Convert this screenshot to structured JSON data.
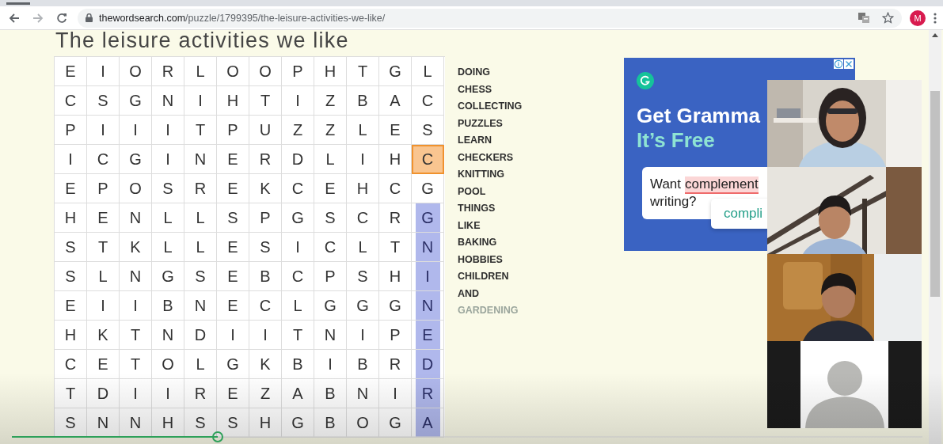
{
  "browser": {
    "url_host": "thewordsearch.com",
    "url_path": "/puzzle/1799395/the-leisure-activities-we-like/",
    "profile_initial": "M"
  },
  "page": {
    "title": "The leisure activities we like"
  },
  "grid": {
    "rows": [
      {
        "cells": [
          {
            "letter": "E",
            "selected": false,
            "found": false
          },
          {
            "letter": "I",
            "selected": false,
            "found": false
          },
          {
            "letter": "O",
            "selected": false,
            "found": false
          },
          {
            "letter": "R",
            "selected": false,
            "found": false
          },
          {
            "letter": "L",
            "selected": false,
            "found": false
          },
          {
            "letter": "O",
            "selected": false,
            "found": false
          },
          {
            "letter": "O",
            "selected": false,
            "found": false
          },
          {
            "letter": "P",
            "selected": false,
            "found": false
          },
          {
            "letter": "H",
            "selected": false,
            "found": false
          },
          {
            "letter": "T",
            "selected": false,
            "found": false
          },
          {
            "letter": "G",
            "selected": false,
            "found": false
          },
          {
            "letter": "L",
            "selected": false,
            "found": false
          }
        ]
      },
      {
        "cells": [
          {
            "letter": "C",
            "selected": false,
            "found": false
          },
          {
            "letter": "S",
            "selected": false,
            "found": false
          },
          {
            "letter": "G",
            "selected": false,
            "found": false
          },
          {
            "letter": "N",
            "selected": false,
            "found": false
          },
          {
            "letter": "I",
            "selected": false,
            "found": false
          },
          {
            "letter": "H",
            "selected": false,
            "found": false
          },
          {
            "letter": "T",
            "selected": false,
            "found": false
          },
          {
            "letter": "I",
            "selected": false,
            "found": false
          },
          {
            "letter": "Z",
            "selected": false,
            "found": false
          },
          {
            "letter": "B",
            "selected": false,
            "found": false
          },
          {
            "letter": "A",
            "selected": false,
            "found": false
          },
          {
            "letter": "C",
            "selected": false,
            "found": false
          }
        ]
      },
      {
        "cells": [
          {
            "letter": "P",
            "selected": false,
            "found": false
          },
          {
            "letter": "I",
            "selected": false,
            "found": false
          },
          {
            "letter": "I",
            "selected": false,
            "found": false
          },
          {
            "letter": "I",
            "selected": false,
            "found": false
          },
          {
            "letter": "T",
            "selected": false,
            "found": false
          },
          {
            "letter": "P",
            "selected": false,
            "found": false
          },
          {
            "letter": "U",
            "selected": false,
            "found": false
          },
          {
            "letter": "Z",
            "selected": false,
            "found": false
          },
          {
            "letter": "Z",
            "selected": false,
            "found": false
          },
          {
            "letter": "L",
            "selected": false,
            "found": false
          },
          {
            "letter": "E",
            "selected": false,
            "found": false
          },
          {
            "letter": "S",
            "selected": false,
            "found": false
          }
        ]
      },
      {
        "cells": [
          {
            "letter": "I",
            "selected": false,
            "found": false
          },
          {
            "letter": "C",
            "selected": false,
            "found": false
          },
          {
            "letter": "G",
            "selected": false,
            "found": false
          },
          {
            "letter": "I",
            "selected": false,
            "found": false
          },
          {
            "letter": "N",
            "selected": false,
            "found": false
          },
          {
            "letter": "E",
            "selected": false,
            "found": false
          },
          {
            "letter": "R",
            "selected": false,
            "found": false
          },
          {
            "letter": "D",
            "selected": false,
            "found": false
          },
          {
            "letter": "L",
            "selected": false,
            "found": false
          },
          {
            "letter": "I",
            "selected": false,
            "found": false
          },
          {
            "letter": "H",
            "selected": false,
            "found": false
          },
          {
            "letter": "C",
            "selected": true,
            "found": false
          }
        ]
      },
      {
        "cells": [
          {
            "letter": "E",
            "selected": false,
            "found": false
          },
          {
            "letter": "P",
            "selected": false,
            "found": false
          },
          {
            "letter": "O",
            "selected": false,
            "found": false
          },
          {
            "letter": "S",
            "selected": false,
            "found": false
          },
          {
            "letter": "R",
            "selected": false,
            "found": false
          },
          {
            "letter": "E",
            "selected": false,
            "found": false
          },
          {
            "letter": "K",
            "selected": false,
            "found": false
          },
          {
            "letter": "C",
            "selected": false,
            "found": false
          },
          {
            "letter": "E",
            "selected": false,
            "found": false
          },
          {
            "letter": "H",
            "selected": false,
            "found": false
          },
          {
            "letter": "C",
            "selected": false,
            "found": false
          },
          {
            "letter": "G",
            "selected": false,
            "found": false
          }
        ]
      },
      {
        "cells": [
          {
            "letter": "H",
            "selected": false,
            "found": false
          },
          {
            "letter": "E",
            "selected": false,
            "found": false
          },
          {
            "letter": "N",
            "selected": false,
            "found": false
          },
          {
            "letter": "L",
            "selected": false,
            "found": false
          },
          {
            "letter": "L",
            "selected": false,
            "found": false
          },
          {
            "letter": "S",
            "selected": false,
            "found": false
          },
          {
            "letter": "P",
            "selected": false,
            "found": false
          },
          {
            "letter": "G",
            "selected": false,
            "found": false
          },
          {
            "letter": "S",
            "selected": false,
            "found": false
          },
          {
            "letter": "C",
            "selected": false,
            "found": false
          },
          {
            "letter": "R",
            "selected": false,
            "found": false
          },
          {
            "letter": "G",
            "selected": false,
            "found": true
          }
        ]
      },
      {
        "cells": [
          {
            "letter": "S",
            "selected": false,
            "found": false
          },
          {
            "letter": "T",
            "selected": false,
            "found": false
          },
          {
            "letter": "K",
            "selected": false,
            "found": false
          },
          {
            "letter": "L",
            "selected": false,
            "found": false
          },
          {
            "letter": "L",
            "selected": false,
            "found": false
          },
          {
            "letter": "E",
            "selected": false,
            "found": false
          },
          {
            "letter": "S",
            "selected": false,
            "found": false
          },
          {
            "letter": "I",
            "selected": false,
            "found": false
          },
          {
            "letter": "C",
            "selected": false,
            "found": false
          },
          {
            "letter": "L",
            "selected": false,
            "found": false
          },
          {
            "letter": "T",
            "selected": false,
            "found": false
          },
          {
            "letter": "N",
            "selected": false,
            "found": true
          }
        ]
      },
      {
        "cells": [
          {
            "letter": "S",
            "selected": false,
            "found": false
          },
          {
            "letter": "L",
            "selected": false,
            "found": false
          },
          {
            "letter": "N",
            "selected": false,
            "found": false
          },
          {
            "letter": "G",
            "selected": false,
            "found": false
          },
          {
            "letter": "S",
            "selected": false,
            "found": false
          },
          {
            "letter": "E",
            "selected": false,
            "found": false
          },
          {
            "letter": "B",
            "selected": false,
            "found": false
          },
          {
            "letter": "C",
            "selected": false,
            "found": false
          },
          {
            "letter": "P",
            "selected": false,
            "found": false
          },
          {
            "letter": "S",
            "selected": false,
            "found": false
          },
          {
            "letter": "H",
            "selected": false,
            "found": false
          },
          {
            "letter": "I",
            "selected": false,
            "found": true
          }
        ]
      },
      {
        "cells": [
          {
            "letter": "E",
            "selected": false,
            "found": false
          },
          {
            "letter": "I",
            "selected": false,
            "found": false
          },
          {
            "letter": "I",
            "selected": false,
            "found": false
          },
          {
            "letter": "B",
            "selected": false,
            "found": false
          },
          {
            "letter": "N",
            "selected": false,
            "found": false
          },
          {
            "letter": "E",
            "selected": false,
            "found": false
          },
          {
            "letter": "C",
            "selected": false,
            "found": false
          },
          {
            "letter": "L",
            "selected": false,
            "found": false
          },
          {
            "letter": "G",
            "selected": false,
            "found": false
          },
          {
            "letter": "G",
            "selected": false,
            "found": false
          },
          {
            "letter": "G",
            "selected": false,
            "found": false
          },
          {
            "letter": "N",
            "selected": false,
            "found": true
          }
        ]
      },
      {
        "cells": [
          {
            "letter": "H",
            "selected": false,
            "found": false
          },
          {
            "letter": "K",
            "selected": false,
            "found": false
          },
          {
            "letter": "T",
            "selected": false,
            "found": false
          },
          {
            "letter": "N",
            "selected": false,
            "found": false
          },
          {
            "letter": "D",
            "selected": false,
            "found": false
          },
          {
            "letter": "I",
            "selected": false,
            "found": false
          },
          {
            "letter": "I",
            "selected": false,
            "found": false
          },
          {
            "letter": "T",
            "selected": false,
            "found": false
          },
          {
            "letter": "N",
            "selected": false,
            "found": false
          },
          {
            "letter": "I",
            "selected": false,
            "found": false
          },
          {
            "letter": "P",
            "selected": false,
            "found": false
          },
          {
            "letter": "E",
            "selected": false,
            "found": true
          }
        ]
      },
      {
        "cells": [
          {
            "letter": "C",
            "selected": false,
            "found": false
          },
          {
            "letter": "E",
            "selected": false,
            "found": false
          },
          {
            "letter": "T",
            "selected": false,
            "found": false
          },
          {
            "letter": "O",
            "selected": false,
            "found": false
          },
          {
            "letter": "L",
            "selected": false,
            "found": false
          },
          {
            "letter": "G",
            "selected": false,
            "found": false
          },
          {
            "letter": "K",
            "selected": false,
            "found": false
          },
          {
            "letter": "B",
            "selected": false,
            "found": false
          },
          {
            "letter": "I",
            "selected": false,
            "found": false
          },
          {
            "letter": "B",
            "selected": false,
            "found": false
          },
          {
            "letter": "R",
            "selected": false,
            "found": false
          },
          {
            "letter": "D",
            "selected": false,
            "found": true
          }
        ]
      },
      {
        "cells": [
          {
            "letter": "T",
            "selected": false,
            "found": false
          },
          {
            "letter": "D",
            "selected": false,
            "found": false
          },
          {
            "letter": "I",
            "selected": false,
            "found": false
          },
          {
            "letter": "I",
            "selected": false,
            "found": false
          },
          {
            "letter": "R",
            "selected": false,
            "found": false
          },
          {
            "letter": "E",
            "selected": false,
            "found": false
          },
          {
            "letter": "Z",
            "selected": false,
            "found": false
          },
          {
            "letter": "A",
            "selected": false,
            "found": false
          },
          {
            "letter": "B",
            "selected": false,
            "found": false
          },
          {
            "letter": "N",
            "selected": false,
            "found": false
          },
          {
            "letter": "I",
            "selected": false,
            "found": false
          },
          {
            "letter": "R",
            "selected": false,
            "found": true
          }
        ]
      },
      {
        "cells": [
          {
            "letter": "S",
            "selected": false,
            "found": false
          },
          {
            "letter": "N",
            "selected": false,
            "found": false
          },
          {
            "letter": "N",
            "selected": false,
            "found": false
          },
          {
            "letter": "H",
            "selected": false,
            "found": false
          },
          {
            "letter": "S",
            "selected": false,
            "found": false
          },
          {
            "letter": "S",
            "selected": false,
            "found": false
          },
          {
            "letter": "H",
            "selected": false,
            "found": false
          },
          {
            "letter": "G",
            "selected": false,
            "found": false
          },
          {
            "letter": "B",
            "selected": false,
            "found": false
          },
          {
            "letter": "O",
            "selected": false,
            "found": false
          },
          {
            "letter": "G",
            "selected": false,
            "found": false
          },
          {
            "letter": "A",
            "selected": false,
            "found": true
          }
        ]
      }
    ]
  },
  "words": [
    {
      "text": "DOING",
      "found": false
    },
    {
      "text": "CHESS",
      "found": false
    },
    {
      "text": "COLLECTING",
      "found": false
    },
    {
      "text": "PUZZLES",
      "found": false
    },
    {
      "text": "LEARN",
      "found": false
    },
    {
      "text": "CHECKERS",
      "found": false
    },
    {
      "text": "KNITTING",
      "found": false
    },
    {
      "text": "POOL",
      "found": false
    },
    {
      "text": "THINGS",
      "found": false
    },
    {
      "text": "LIKE",
      "found": false
    },
    {
      "text": "BAKING",
      "found": false
    },
    {
      "text": "HOBBIES",
      "found": false
    },
    {
      "text": "CHILDREN",
      "found": false
    },
    {
      "text": "AND",
      "found": false
    },
    {
      "text": "GARDENING",
      "found": true
    }
  ],
  "ad": {
    "headline": "Get Gramma",
    "subline": "It’s Free",
    "card_start": "Want",
    "card_highlight": "complement",
    "card_end": "writing?",
    "suggestion": "compli"
  },
  "videos": [
    {
      "kind": "picture"
    },
    {
      "kind": "picture"
    },
    {
      "kind": "picture"
    },
    {
      "kind": "avatar"
    }
  ],
  "player": {
    "level": 0.226
  }
}
